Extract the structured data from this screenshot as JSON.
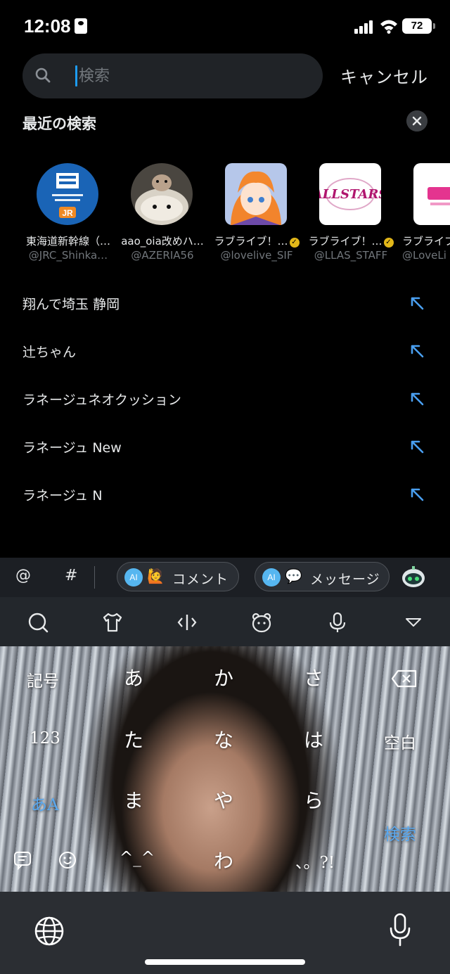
{
  "status_bar": {
    "time": "12:08",
    "battery": "72"
  },
  "search": {
    "placeholder": "検索",
    "cancel_label": "キャンセル"
  },
  "recent": {
    "title": "最近の検索",
    "accounts": [
      {
        "name": "東海道新幹線（…",
        "handle": "@JRC_Shinka…",
        "verified": false
      },
      {
        "name": "aao_oia改めハ…",
        "handle": "@AZERIA56",
        "verified": false
      },
      {
        "name": "ラブライブ！…",
        "handle": "@lovelive_SIF",
        "verified": true
      },
      {
        "name": "ラブライブ！…",
        "handle": "@LLAS_STAFF",
        "verified": true
      },
      {
        "name": "ラブライブ",
        "handle": "@LoveLi",
        "verified": false
      }
    ],
    "queries": [
      "翔んで埼玉 静岡",
      "辻ちゃん",
      "ラネージュネオクッション",
      "ラネージュ New",
      "ラネージュ N"
    ]
  },
  "keyboard": {
    "suggest": {
      "at": "@",
      "hash": "#",
      "ai_label": "AI",
      "comment_chip": "コメント",
      "message_chip": "メッセージ"
    },
    "keys": {
      "symbols": "記号",
      "a": "あ",
      "ka": "か",
      "sa": "さ",
      "num": "123",
      "ta": "た",
      "na": "な",
      "ha": "は",
      "space": "空白",
      "mode": "あA",
      "ma": "ま",
      "ya": "や",
      "ra": "ら",
      "search": "検索",
      "kaomoji": "^_^",
      "wa": "わ",
      "punct": "、。?!"
    }
  }
}
